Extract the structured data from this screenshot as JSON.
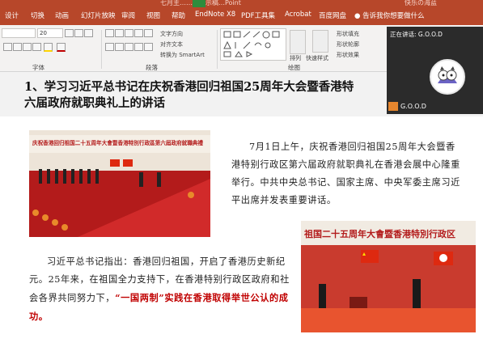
{
  "window": {
    "doc_title": "七月主…………示稿…Point",
    "user": "快乐の海蓝"
  },
  "tabs": [
    "设计",
    "切换",
    "动画",
    "幻灯片放映",
    "审阅",
    "视图",
    "帮助",
    "EndNote X8",
    "PDF工具集",
    "Acrobat",
    "百度网盘"
  ],
  "tell_me": "告诉我你想要做什么",
  "ribbon": {
    "font_size": "20",
    "text_direction": "文字方向",
    "align_text": "对齐文本",
    "convert_smartart": "转换为 SmartArt",
    "arrange": "排列",
    "quick_styles": "快速样式",
    "shape_fill": "形状填充",
    "shape_outline": "形状轮廓",
    "shape_effects": "形状效果",
    "group_font": "字体",
    "group_paragraph": "段落",
    "group_drawing": "绘图"
  },
  "slide": {
    "title_line1": "1、学习习近平总书记在庆祝香港回归祖国25周年大会暨香港特",
    "title_line2": "六届政府就职典礼上的讲话",
    "para1": "7月1日上午，庆祝香港回归祖国25周年大会暨香港特别行政区第六届政府就职典礼在香港会展中心隆重举行。中共中央总书记、国家主席、中央军委主席习近平出席并发表重要讲话。",
    "para2_a": "习近平总书记指出：香港回归祖国，开启了香港历史新纪元。25年来，在祖国全力支持下，在香港特别行政区政府和社会各界共同努力下，",
    "para2_red": "“一国两制”实践在香港取得举世公认的成功。",
    "photo1_banner": "庆祝香港回归祖国二十五周年大會暨香港特別行政區第六屆政府就職典禮",
    "photo2_banner": "祖国二十五周年大會暨香港特別行政区"
  },
  "meeting": {
    "speaking": "正在讲话: G.O.O.D",
    "name": "G.O.O.D"
  },
  "colors": {
    "accent": "#b7472a",
    "stage_red": "#c8262a"
  }
}
